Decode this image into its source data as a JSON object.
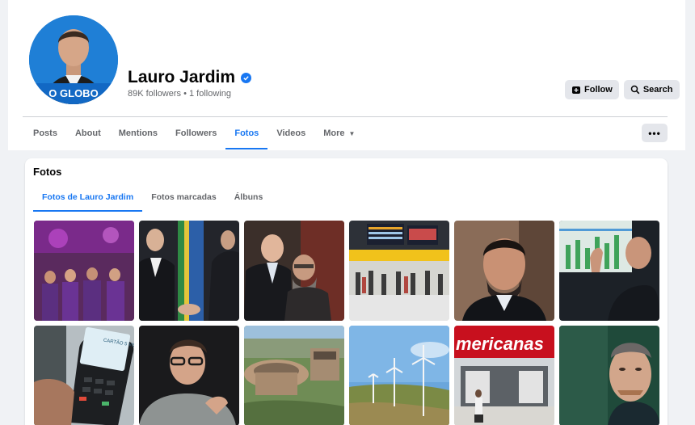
{
  "profile": {
    "name": "Lauro Jardim",
    "stats": "89K followers • 1 following",
    "avatar_label": "O GLOBO",
    "verified": true
  },
  "actions": {
    "follow_label": "Follow",
    "search_label": "Search"
  },
  "tabs": [
    {
      "label": "Posts"
    },
    {
      "label": "About"
    },
    {
      "label": "Mentions"
    },
    {
      "label": "Followers"
    },
    {
      "label": "Fotos",
      "active": true
    },
    {
      "label": "Videos"
    },
    {
      "label": "More"
    }
  ],
  "more_menu_label": "•••",
  "photos": {
    "title": "Fotos",
    "subtabs": [
      {
        "label": "Fotos de Lauro Jardim",
        "active": true
      },
      {
        "label": "Fotos marcadas"
      },
      {
        "label": "Álbuns"
      }
    ],
    "store_sign": "mericanas",
    "card_screen_text": "CARTÃO 5 VISTA"
  },
  "colors": {
    "accent": "#1877f2",
    "avatar_bg": "#1877d2",
    "button_bg": "#e4e6eb",
    "page_bg": "#f0f2f5"
  }
}
